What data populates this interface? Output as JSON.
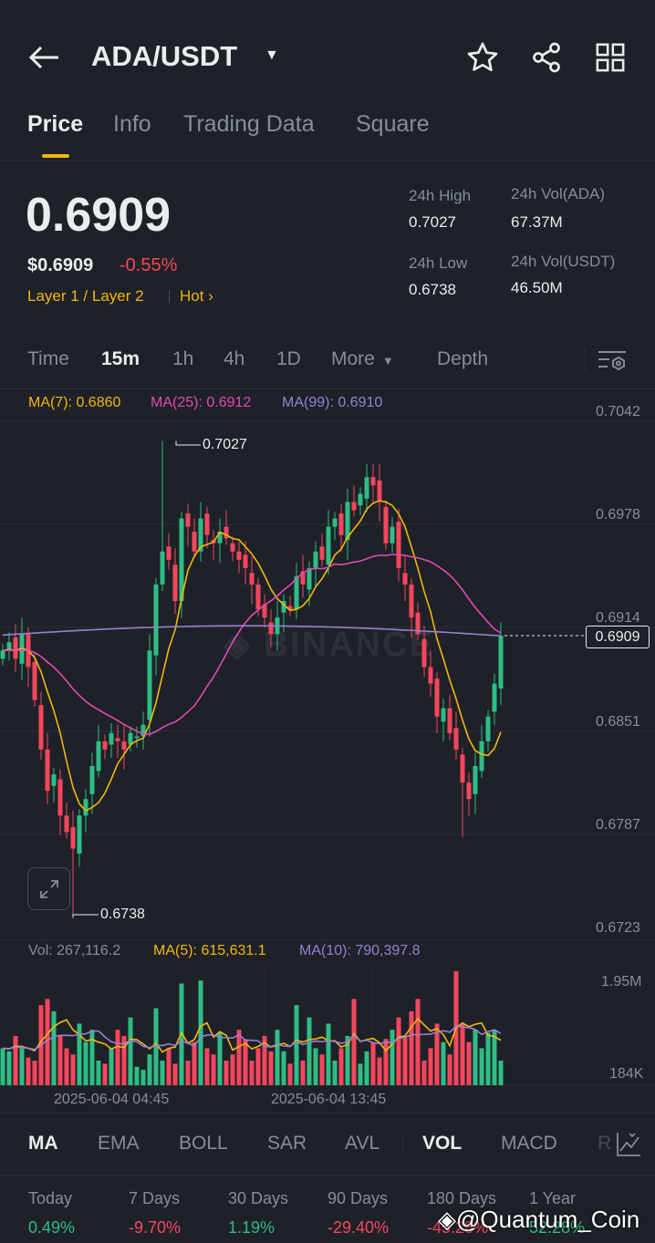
{
  "header": {
    "title": "ADA/USDT",
    "icons": [
      "back-arrow-icon",
      "star-icon",
      "share-icon",
      "grid-icon"
    ]
  },
  "tabs": [
    {
      "label": "Price"
    },
    {
      "label": "Info"
    },
    {
      "label": "Trading Data"
    },
    {
      "label": "Square"
    }
  ],
  "price": {
    "last": "0.6909",
    "usd": "$0.6909",
    "change": "-0.55%",
    "tags": "Layer 1 / Layer 2",
    "hot": "Hot"
  },
  "stats": {
    "high_label": "24h High",
    "high": "0.7027",
    "low_label": "24h Low",
    "low": "0.6738",
    "vol_ada_label": "24h Vol(ADA)",
    "vol_ada": "67.37M",
    "vol_usdt_label": "24h Vol(USDT)",
    "vol_usdt": "46.50M"
  },
  "intervals": [
    {
      "label": "Time"
    },
    {
      "label": "15m"
    },
    {
      "label": "1h"
    },
    {
      "label": "4h"
    },
    {
      "label": "1D"
    },
    {
      "label": "More"
    },
    {
      "label": "Depth"
    }
  ],
  "ma_legend": {
    "ma7": "MA(7): 0.6860",
    "ma25": "MA(25): 0.6912",
    "ma99": "MA(99): 0.6910"
  },
  "price_axis": [
    "0.7042",
    "0.6978",
    "0.6914",
    "0.6851",
    "0.6787",
    "0.6723"
  ],
  "current_price_tag": "0.6909",
  "annotations": {
    "high": "0.7027",
    "low": "0.6738"
  },
  "watermark": "BINANCE",
  "vol_legend": {
    "vol": "Vol: 267,116.2",
    "ma5": "MA(5): 615,631.1",
    "ma10": "MA(10): 790,397.8"
  },
  "vol_axis": {
    "top": "1.95M",
    "bottom": "184K"
  },
  "time_axis": [
    "2025-06-04 04:45",
    "2025-06-04 13:45"
  ],
  "indicators": [
    {
      "label": "MA"
    },
    {
      "label": "EMA"
    },
    {
      "label": "BOLL"
    },
    {
      "label": "SAR"
    },
    {
      "label": "AVL"
    },
    {
      "label": "VOL"
    },
    {
      "label": "MACD"
    },
    {
      "label": "R"
    }
  ],
  "performance": [
    {
      "label": "Today",
      "value": "0.49%",
      "dir": "up"
    },
    {
      "label": "7 Days",
      "value": "-9.70%",
      "dir": "down"
    },
    {
      "label": "30 Days",
      "value": "1.19%",
      "dir": "up"
    },
    {
      "label": "90 Days",
      "value": "-29.40%",
      "dir": "down"
    },
    {
      "label": "180 Days",
      "value": "-45.28%",
      "dir": "down"
    },
    {
      "label": "1 Year",
      "value": "52.28%",
      "dir": "up"
    }
  ],
  "user_watermark": "@Quantum_Coin",
  "colors": {
    "up": "#2ebd85",
    "down": "#f6465d",
    "ma7": "#f0b90b",
    "ma25": "#e04bb3",
    "ma99": "#9b7fd4"
  },
  "chart_data": {
    "type": "candlestick",
    "interval": "15m",
    "closes": [
      0.69,
      0.6905,
      0.6895,
      0.691,
      0.689,
      0.687,
      0.684,
      0.6815,
      0.6825,
      0.68,
      0.679,
      0.678,
      0.68,
      0.681,
      0.683,
      0.6845,
      0.684,
      0.685,
      0.6845,
      0.684,
      0.685,
      0.6848,
      0.6855,
      0.69,
      0.694,
      0.696,
      0.6955,
      0.693,
      0.698,
      0.6975,
      0.696,
      0.698,
      0.697,
      0.6965,
      0.6972,
      0.6968,
      0.696,
      0.6955,
      0.695,
      0.694,
      0.6925,
      0.692,
      0.691,
      0.692,
      0.693,
      0.6925,
      0.6945,
      0.694,
      0.695,
      0.696,
      0.6955,
      0.6975,
      0.698,
      0.697,
      0.699,
      0.6985,
      0.6995,
      0.7005,
      0.7,
      0.699,
      0.6965,
      0.6975,
      0.695,
      0.694,
      0.692,
      0.691,
      0.689,
      0.688,
      0.686,
      0.6865,
      0.685,
      0.684,
      0.682,
      0.681,
      0.683,
      0.6845,
      0.686,
      0.688,
      0.6909
    ],
    "volumes_k": [
      700,
      650,
      900,
      700,
      550,
      500,
      1400,
      1500,
      1300,
      900,
      700,
      600,
      1100,
      800,
      1000,
      500,
      450,
      700,
      1000,
      900,
      1200,
      400,
      350,
      600,
      1350,
      500,
      700,
      450,
      1750,
      500,
      800,
      1800,
      700,
      600,
      950,
      500,
      600,
      1000,
      850,
      500,
      700,
      900,
      650,
      1000,
      650,
      450,
      1400,
      500,
      1200,
      700,
      600,
      1100,
      500,
      700,
      900,
      1500,
      450,
      650,
      800,
      550,
      850,
      1000,
      1200,
      900,
      1300,
      1500,
      500,
      700,
      1100,
      800,
      600,
      1950,
      1100,
      800,
      1000,
      700,
      950,
      1000,
      500
    ],
    "high": 0.7027,
    "low": 0.6738,
    "ylim": [
      0.6723,
      0.7042
    ]
  }
}
